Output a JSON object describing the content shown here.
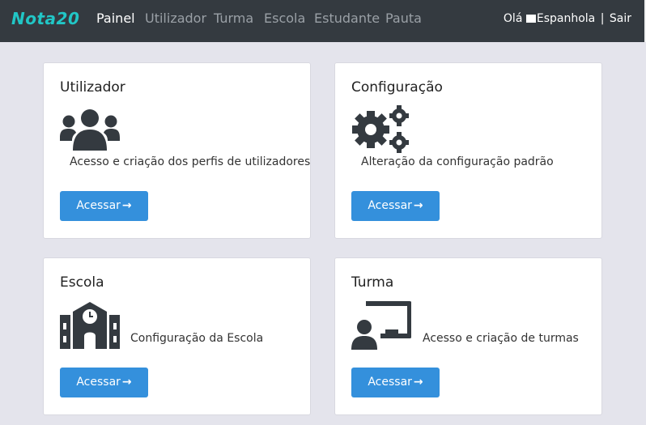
{
  "brand": "Nota20",
  "nav": {
    "items": [
      "Painel",
      "Utilizador",
      "Turma",
      "Escola",
      "Estudante",
      "Pauta"
    ],
    "active_index": 0
  },
  "user": {
    "greeting": "Olá",
    "name": "Espanhola",
    "separator": "|",
    "logout": "Sair"
  },
  "cards": [
    {
      "title": "Utilizador",
      "icon": "users-icon",
      "description": "Acesso e criação dos perfis de utilizadores",
      "button": "Acessar"
    },
    {
      "title": "Configuração",
      "icon": "gears-icon",
      "description": "Alteração da configuração padrão",
      "button": "Acessar"
    },
    {
      "title": "Escola",
      "icon": "school-icon",
      "description": "Configuração da Escola",
      "button": "Acessar"
    },
    {
      "title": "Turma",
      "icon": "classroom-icon",
      "description": "Acesso e criação de turmas",
      "button": "Acessar"
    }
  ],
  "colors": {
    "navbar": "#343a40",
    "brand": "#21c6c6",
    "button": "#3490dc",
    "page_bg": "#e4e4ec",
    "icon": "#343a40"
  }
}
